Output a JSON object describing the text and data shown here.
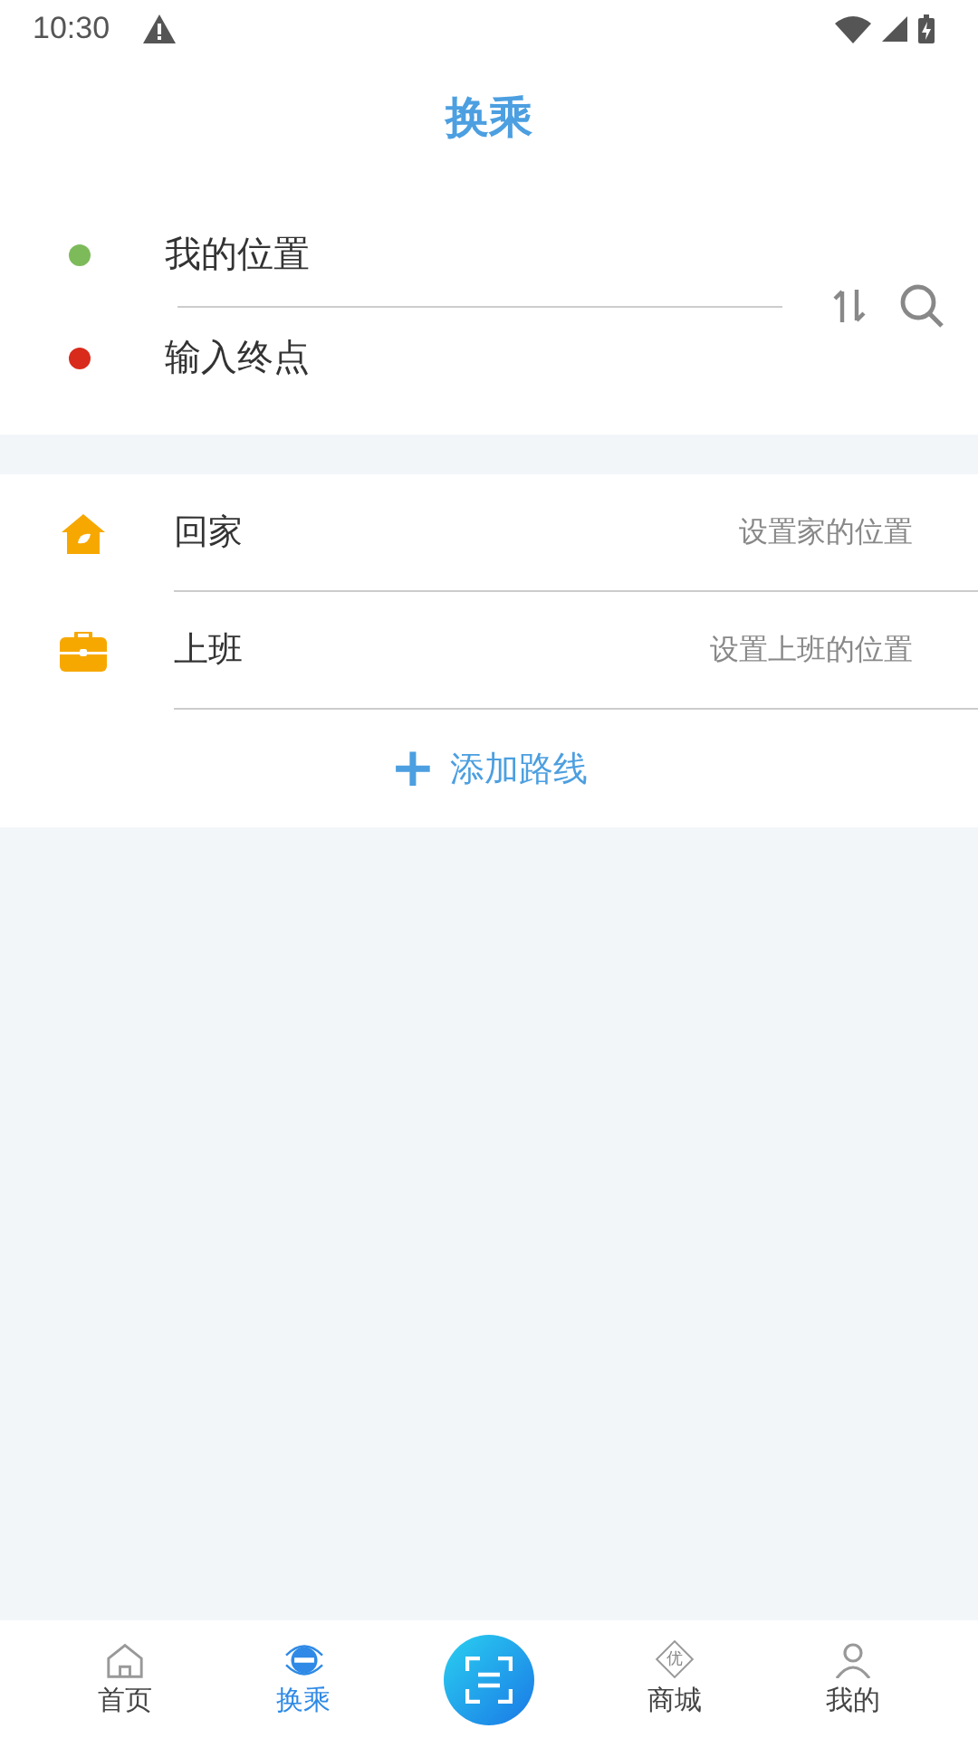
{
  "status_bar": {
    "time": "10:30"
  },
  "title": "换乘",
  "route": {
    "points": [
      {
        "label": "我的位置",
        "color": "#7dbb5a"
      },
      {
        "label": "输入终点",
        "color": "#d92b1c"
      }
    ]
  },
  "shortcuts": [
    {
      "kind": "home",
      "label": "回家",
      "hint": "设置家的位置"
    },
    {
      "kind": "work",
      "label": "上班",
      "hint": "设置上班的位置"
    }
  ],
  "add_route": {
    "icon": "+",
    "label": "添加路线"
  },
  "bottom_nav": [
    {
      "kind": "home",
      "label": "首页",
      "selected": false
    },
    {
      "kind": "transfer",
      "label": "换乘",
      "selected": true
    },
    {
      "kind": "scan"
    },
    {
      "kind": "mall",
      "label": "商城",
      "badge": "优",
      "selected": false
    },
    {
      "kind": "me",
      "label": "我的",
      "selected": false
    }
  ]
}
